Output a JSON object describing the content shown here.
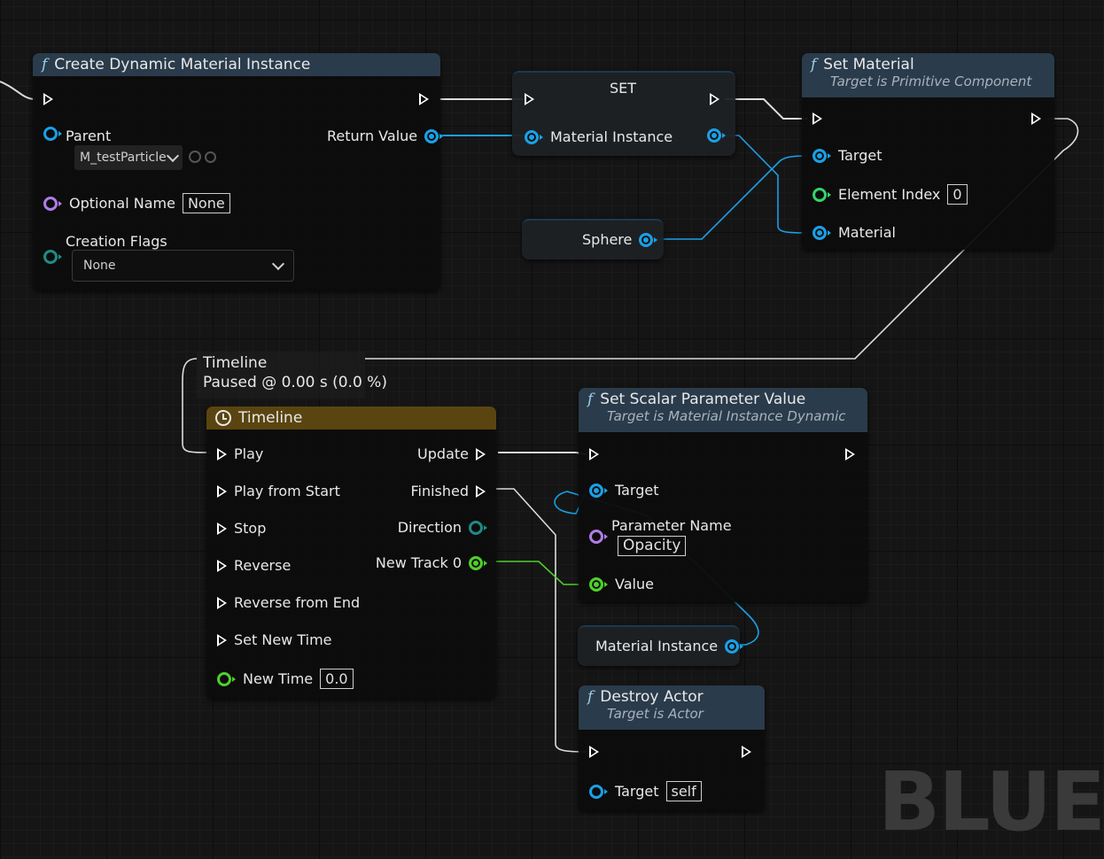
{
  "nodes": {
    "create_dmi": {
      "title": "Create Dynamic Material Instance",
      "parent_label": "Parent",
      "parent_value": "M_testParticle",
      "return_value_label": "Return Value",
      "optional_name_label": "Optional Name",
      "optional_name_value": "None",
      "creation_flags_label": "Creation Flags",
      "creation_flags_value": "None"
    },
    "set_node": {
      "title": "SET",
      "material_instance_label": "Material Instance"
    },
    "sphere": {
      "label": "Sphere"
    },
    "set_material": {
      "title": "Set Material",
      "subtitle": "Target is Primitive Component",
      "target_label": "Target",
      "element_index_label": "Element Index",
      "element_index_value": "0",
      "material_label": "Material"
    },
    "timeline_comment": {
      "title": "Timeline",
      "status": "Paused @ 0.00 s (0.0 %)"
    },
    "timeline": {
      "title": "Timeline",
      "inputs": [
        "Play",
        "Play from Start",
        "Stop",
        "Reverse",
        "Reverse from End",
        "Set New Time"
      ],
      "new_time_label": "New Time",
      "new_time_value": "0.0",
      "update_label": "Update",
      "finished_label": "Finished",
      "direction_label": "Direction",
      "new_track_label": "New Track 0"
    },
    "set_scalar": {
      "title": "Set Scalar Parameter Value",
      "subtitle": "Target is Material Instance Dynamic",
      "target_label": "Target",
      "parameter_name_label": "Parameter Name",
      "parameter_name_value": "Opacity",
      "value_label": "Value"
    },
    "material_instance_var": {
      "label": "Material Instance"
    },
    "destroy_actor": {
      "title": "Destroy Actor",
      "subtitle": "Target is Actor",
      "target_label": "Target",
      "target_value": "self"
    }
  },
  "watermark": "BLUE",
  "colors": {
    "exec": "#ffffff",
    "object_pin": "#1aa0e6",
    "name_pin": "#b07ce6",
    "int_pin": "#34d36b",
    "float_pin": "#4fd02a",
    "enum_pin": "#1f8a86",
    "function_header": "#2a3b4b",
    "timeline_header": "#5a4510"
  }
}
